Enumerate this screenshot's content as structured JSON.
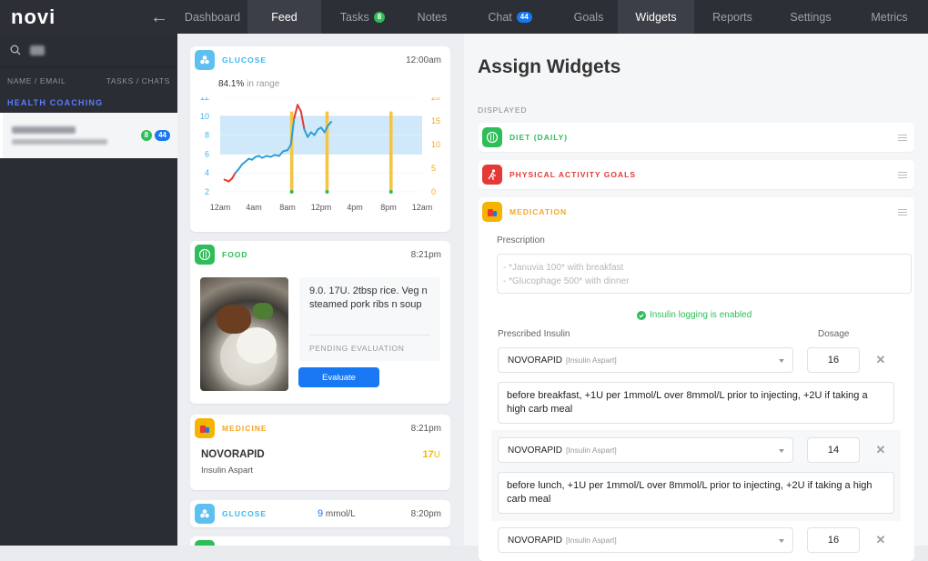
{
  "app": {
    "logo": "novi"
  },
  "nav": [
    {
      "label": "Dashboard"
    },
    {
      "label": "Feed",
      "active": true
    },
    {
      "label": "Tasks",
      "badge": "8",
      "badge_color": "#2ebd59"
    },
    {
      "label": "Notes"
    },
    {
      "label": "Chat",
      "badge": "44",
      "badge_color": "#1877f2"
    },
    {
      "label": "Goals"
    },
    {
      "label": "Widgets",
      "active": true
    },
    {
      "label": "Reports"
    },
    {
      "label": "Settings"
    },
    {
      "label": "Metrics"
    }
  ],
  "sidebar": {
    "col_name": "NAME / EMAIL",
    "col_tasks": "TASKS / CHATS",
    "section": "HEALTH COACHING",
    "member": {
      "tasks": "8",
      "chats": "44"
    }
  },
  "feed": {
    "glucose_card": {
      "title": "GLUCOSE",
      "time": "12:00am",
      "in_range_pct": "84.1%",
      "in_range_text": "in range"
    },
    "food_card": {
      "title": "FOOD",
      "time": "8:21pm",
      "text": "9.0. 17U. 2tbsp rice. Veg n steamed pork ribs n soup",
      "status": "PENDING EVALUATION",
      "button": "Evaluate"
    },
    "medicine_card": {
      "title": "MEDICINE",
      "time": "8:21pm",
      "name": "NOVORAPID",
      "sub": "Insulin Aspart",
      "dose": "17",
      "unit": "U"
    },
    "glucose_card2": {
      "title": "GLUCOSE",
      "time": "8:20pm",
      "value": "9",
      "unit": "mmol/L"
    }
  },
  "chart_data": {
    "type": "line",
    "title": "",
    "x_ticks": [
      "12am",
      "4am",
      "8am",
      "12pm",
      "4pm",
      "8pm",
      "12am"
    ],
    "xlim": [
      0,
      24
    ],
    "ylim_left": [
      2,
      12
    ],
    "y_ticks_left": [
      2,
      4,
      6,
      8,
      10,
      12
    ],
    "ylim_right": [
      0,
      20
    ],
    "y_ticks_right": [
      0,
      5,
      10,
      15,
      20
    ],
    "target_range": [
      6,
      10
    ],
    "series": [
      {
        "x": [
          0.5,
          1.0,
          1.4,
          1.8,
          2.2,
          2.6,
          3.0,
          3.4,
          3.8,
          4.2,
          4.6,
          5.0,
          5.5,
          6.0,
          6.5,
          7.0,
          7.5,
          8.0,
          8.4,
          8.8,
          9.2,
          9.6,
          10.0,
          10.4,
          10.8,
          11.2,
          11.6,
          12.0,
          12.4,
          12.8,
          13.2
        ],
        "y": [
          3.3,
          3.1,
          3.4,
          4.0,
          4.4,
          4.9,
          5.2,
          5.5,
          5.4,
          5.7,
          5.8,
          5.6,
          5.8,
          5.7,
          5.9,
          5.8,
          6.3,
          6.4,
          7.0,
          9.8,
          11.2,
          10.5,
          8.6,
          7.8,
          8.3,
          8.0,
          8.6,
          8.8,
          8.3,
          9.0,
          9.4
        ]
      }
    ],
    "insulin_bars": [
      {
        "x": 8.5,
        "value": 17
      },
      {
        "x": 12.7,
        "value": 17
      },
      {
        "x": 20.3,
        "value": 17
      }
    ]
  },
  "widgets": {
    "title": "Assign Widgets",
    "displayed_label": "DISPLAYED",
    "items": [
      {
        "name": "DIET (DAILY)",
        "color": "#2ebd59"
      },
      {
        "name": "PHYSICAL ACTIVITY GOALS",
        "color": "#e53935"
      },
      {
        "name": "MEDICATION",
        "color": "#f5a623"
      }
    ],
    "medication": {
      "prescription_label": "Prescription",
      "prescription_placeholder_1": "- *Januvia 100* with breakfast",
      "prescription_placeholder_2": "- *Glucophage 500* with dinner",
      "insulin_status": "Insulin logging is enabled",
      "prescribed_insulin_label": "Prescribed Insulin",
      "dosage_label": "Dosage",
      "insulins": [
        {
          "name": "NOVORAPID",
          "type": "[Insulin Aspart]",
          "dose": "16",
          "note": "before breakfast, +1U per 1mmol/L over 8mmol/L prior to injecting, +2U if taking a high carb meal"
        },
        {
          "name": "NOVORAPID",
          "type": "[Insulin Aspart]",
          "dose": "14",
          "note": "before lunch, +1U per 1mmol/L over 8mmol/L prior to injecting, +2U if taking a high carb meal"
        },
        {
          "name": "NOVORAPID",
          "type": "[Insulin Aspart]",
          "dose": "16"
        }
      ]
    }
  }
}
